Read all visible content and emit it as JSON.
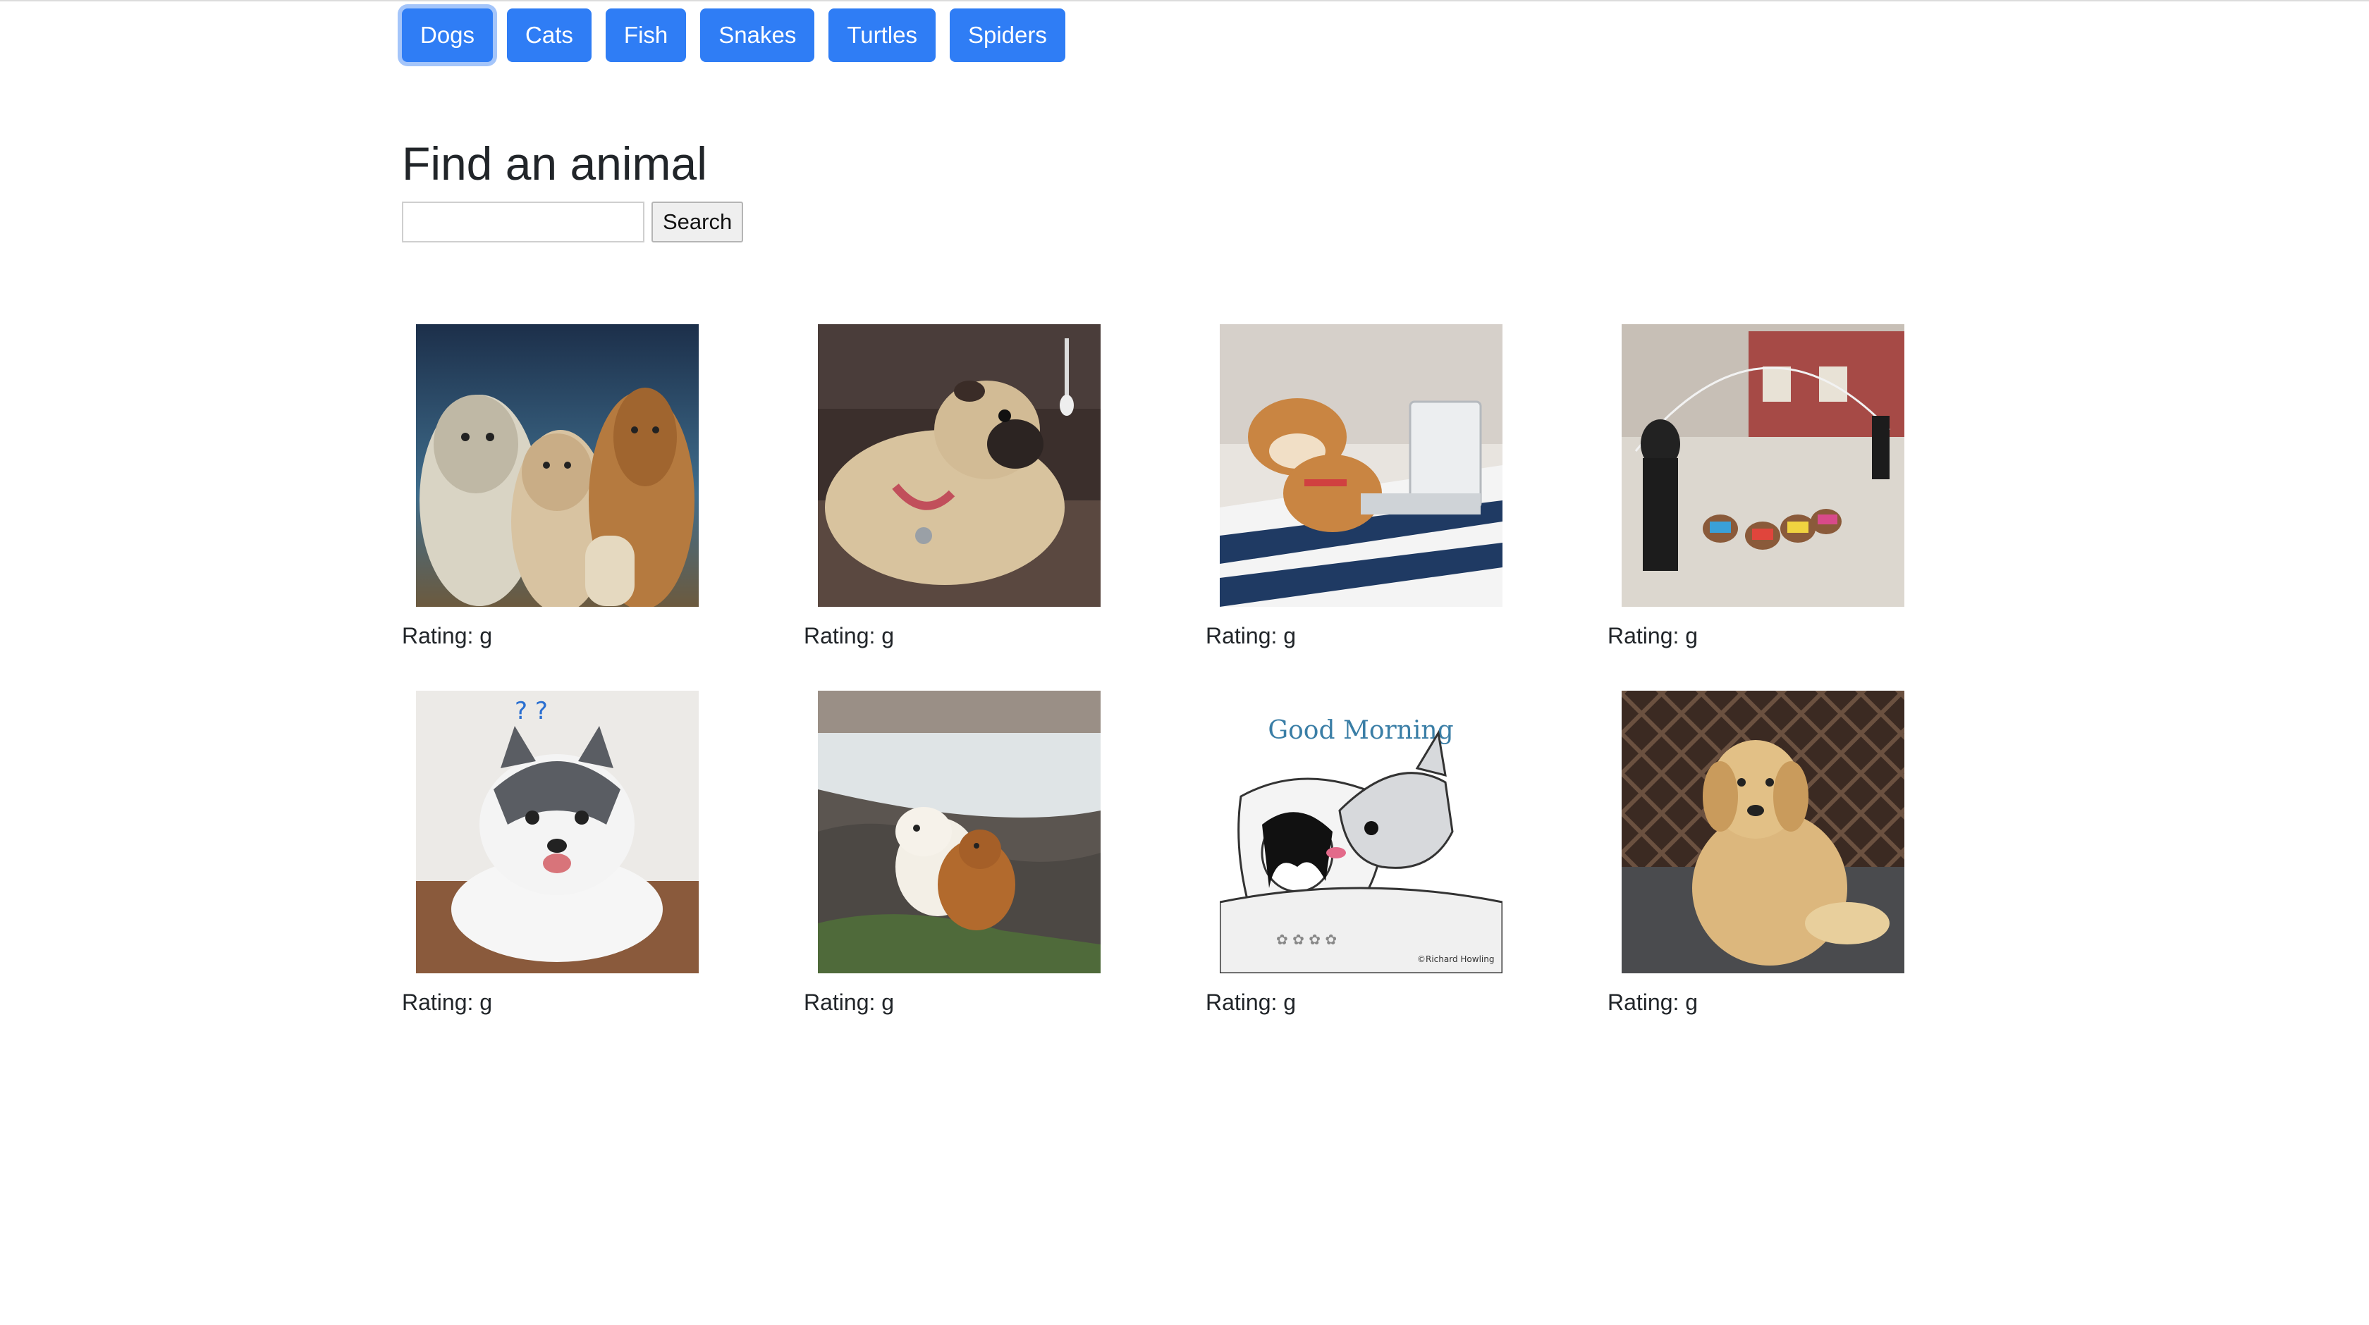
{
  "nav": {
    "buttons": [
      {
        "label": "Dogs",
        "active": true
      },
      {
        "label": "Cats"
      },
      {
        "label": "Fish"
      },
      {
        "label": "Snakes"
      },
      {
        "label": "Turtles"
      },
      {
        "label": "Spiders"
      }
    ]
  },
  "main": {
    "heading": "Find an animal",
    "search": {
      "value": "",
      "placeholder": "",
      "button_label": "Search"
    }
  },
  "results": [
    {
      "image": "group-of-dogs-gif",
      "rating": "Rating: g"
    },
    {
      "image": "pug-on-couch-gif",
      "rating": "Rating: g"
    },
    {
      "image": "shiba-with-laptop-gif",
      "rating": "Rating: g"
    },
    {
      "image": "dogs-jumping-rope-gif",
      "rating": "Rating: g"
    },
    {
      "image": "husky-puppy-gif",
      "rating": "Rating: g"
    },
    {
      "image": "dogs-hugging-by-river-gif",
      "rating": "Rating: g"
    },
    {
      "image": "good-morning-cartoon-gif",
      "rating": "Rating: g",
      "caption": "Good Morning",
      "credit": "©Richard Howling"
    },
    {
      "image": "golden-retriever-gif",
      "rating": "Rating: g"
    }
  ],
  "colors": {
    "primary": "#2f7df5",
    "text": "#212529"
  }
}
